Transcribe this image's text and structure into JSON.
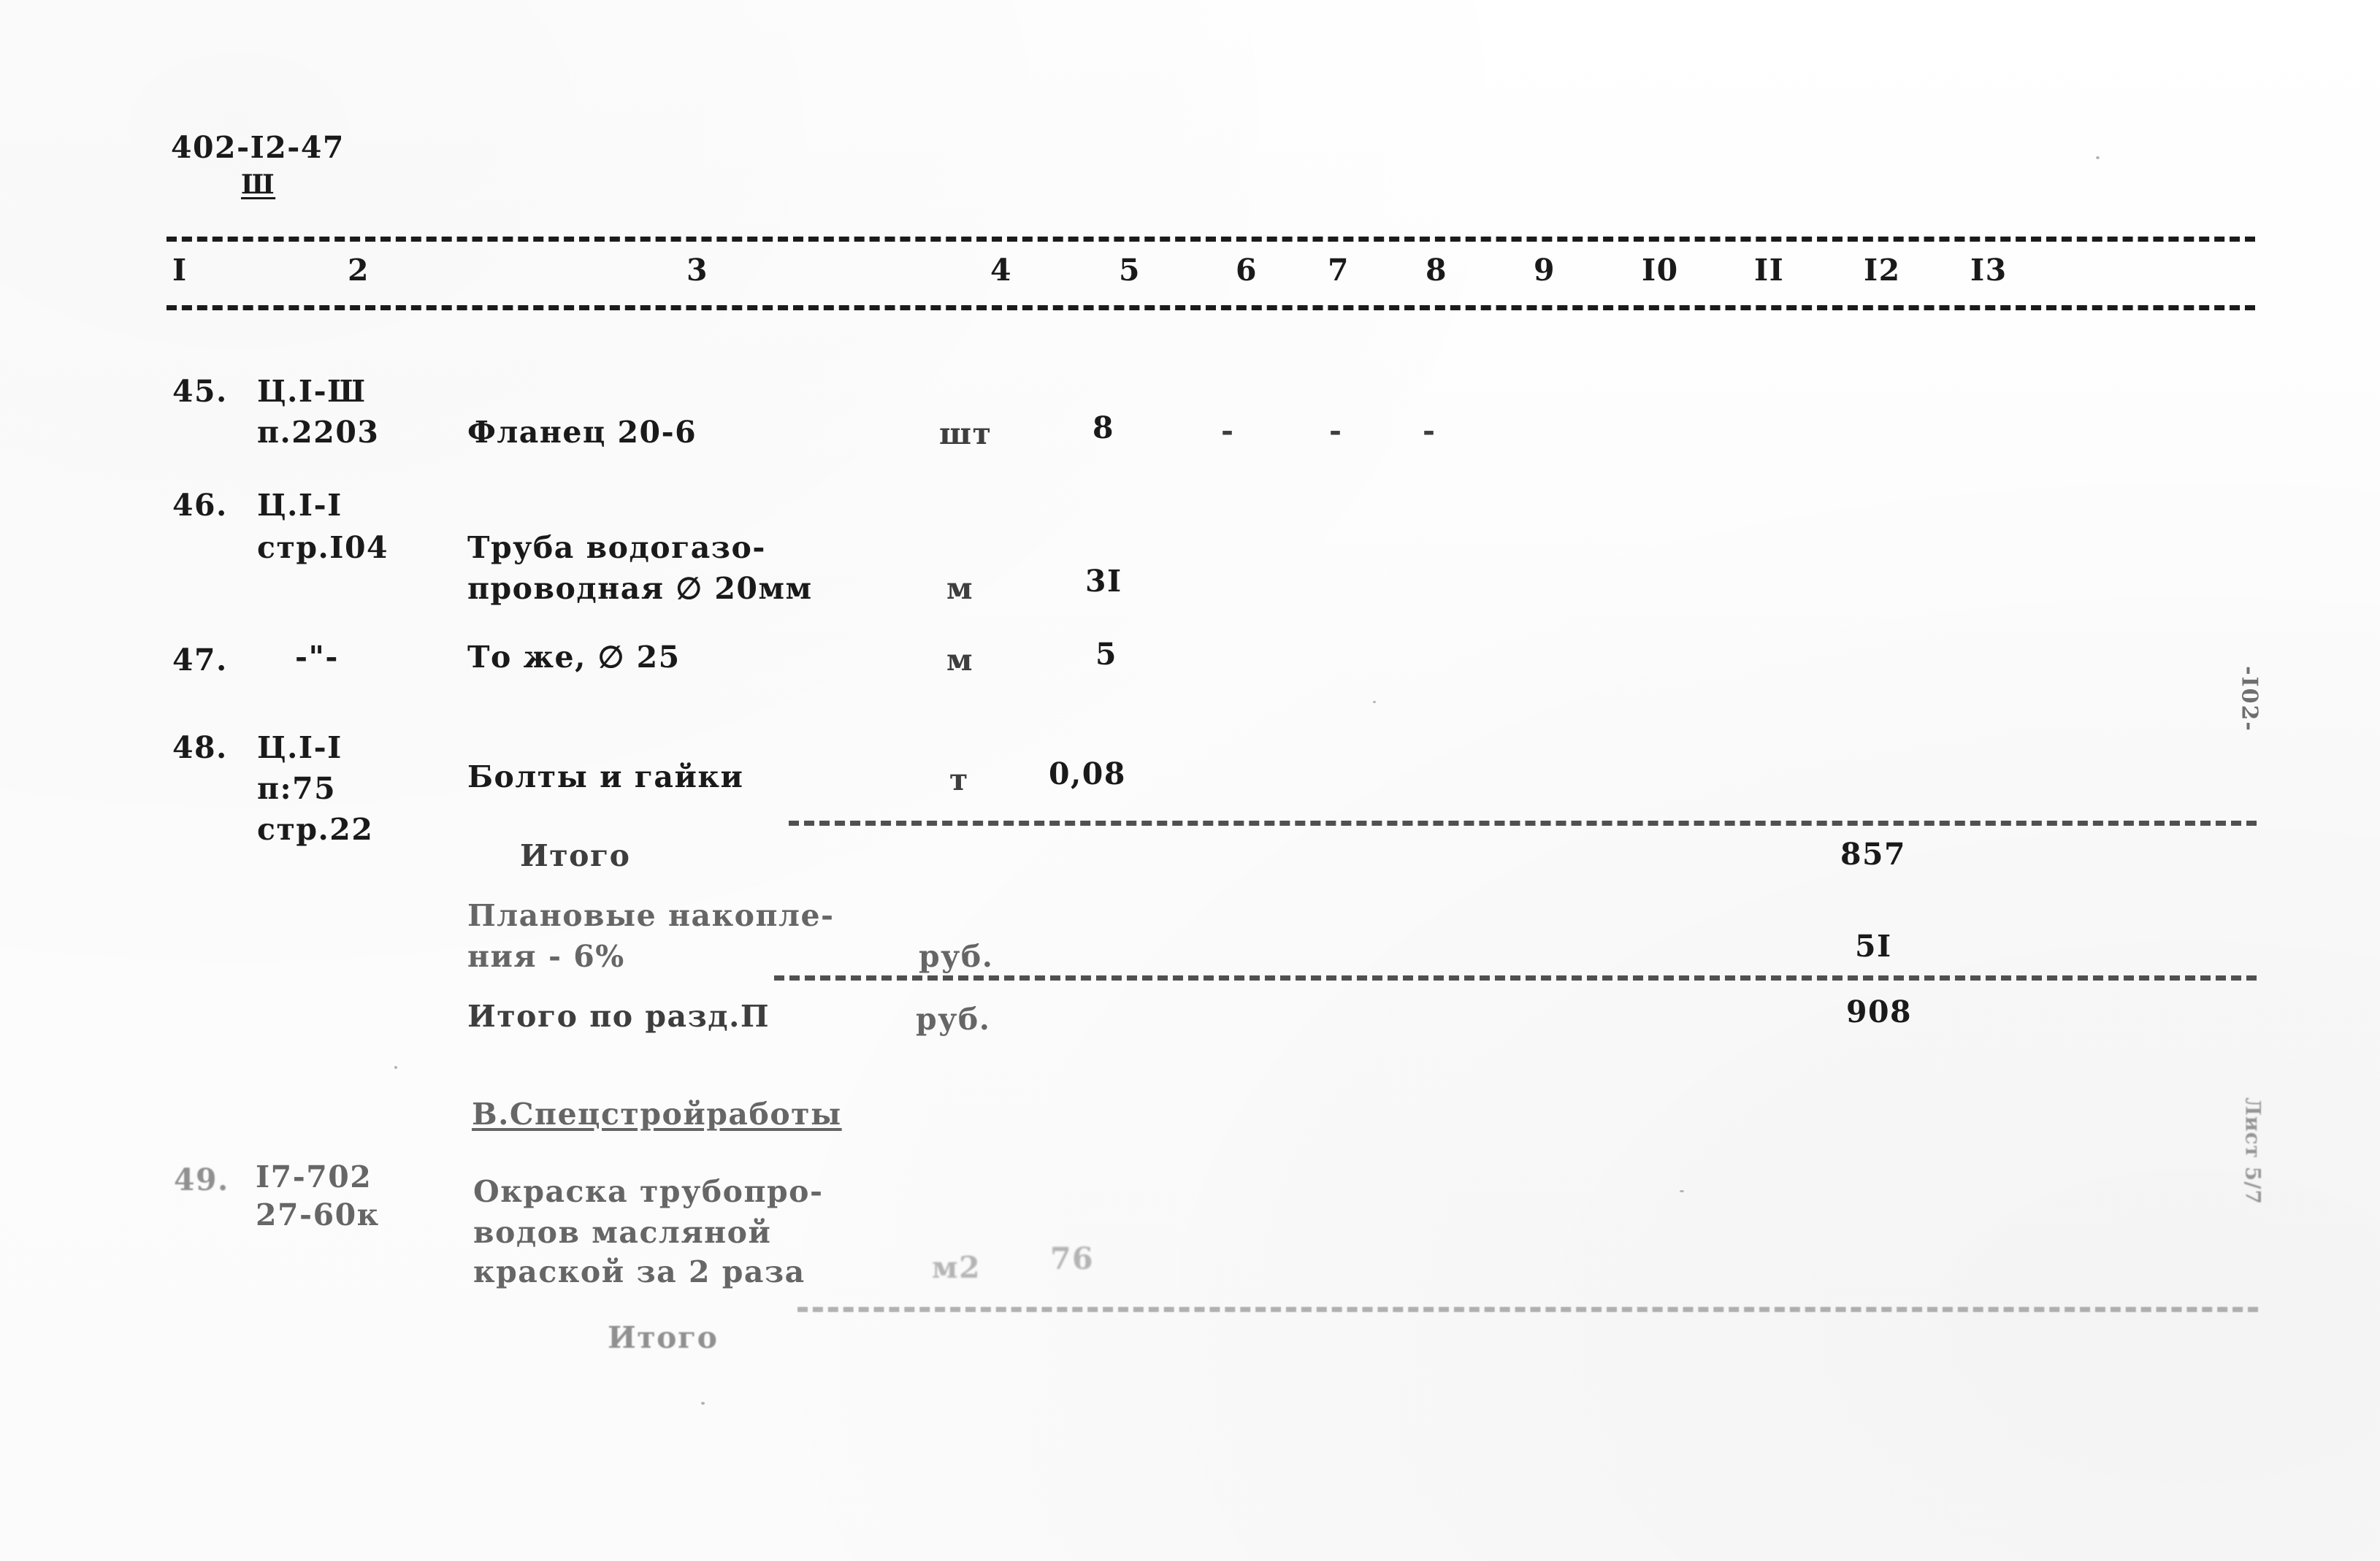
{
  "document": {
    "code": "402-I2-47",
    "sheet_marker": "Ш",
    "page_number_margin": "-I02-",
    "margin_stamp_lower": "Лист 5/7"
  },
  "table": {
    "column_headers": [
      "I",
      "2",
      "3",
      "4",
      "5",
      "6",
      "7",
      "8",
      "9",
      "I0",
      "II",
      "I2",
      "I3"
    ],
    "rows": [
      {
        "no": "45.",
        "ref_line1": "Ц.I-Ш",
        "ref_line2": "п.2203",
        "name_line1": "Фланец 20-6",
        "name_line2": "",
        "name_line3": "",
        "unit": "шт",
        "qty": "8",
        "c6": "-",
        "c7": "-",
        "c8": "-"
      },
      {
        "no": "46.",
        "ref_line1": "Ц.I-I",
        "ref_line2": "стр.I04",
        "name_line1": "Труба водогазо-",
        "name_line2": "проводная ∅ 20мм",
        "name_line3": "",
        "unit": "м",
        "qty": "3I",
        "c6": "",
        "c7": "",
        "c8": ""
      },
      {
        "no": "47.",
        "ref_line1": "-\"-",
        "ref_line2": "",
        "name_line1": "То же, ∅ 25",
        "name_line2": "",
        "name_line3": "",
        "unit": "м",
        "qty": "5",
        "c6": "",
        "c7": "",
        "c8": ""
      },
      {
        "no": "48.",
        "ref_line1": "Ц.I-I",
        "ref_line2": "п:75",
        "ref_line3": "стр.22",
        "name_line1": "Болты и гайки",
        "name_line2": "",
        "name_line3": "",
        "unit": "т",
        "qty": "0,08",
        "c6": "",
        "c7": "",
        "c8": ""
      }
    ],
    "totals": [
      {
        "label": "Итого",
        "label2": "",
        "unit": "",
        "value": "857"
      },
      {
        "label": "Плановые накопле-",
        "label2": "ния - 6%",
        "unit": "руб.",
        "value": "5I"
      },
      {
        "label": "Итого по разд.П",
        "label2": "",
        "unit": "руб.",
        "value": "908"
      }
    ],
    "section": {
      "heading": "В.Спецстройработы",
      "row": {
        "no": "49.",
        "ref_line1": "I7-702",
        "ref_line2": "27-60к",
        "name_line1": "Окраска трубопро-",
        "name_line2": "водов масляной",
        "name_line3": "краской за 2 раза",
        "unit": "м2",
        "qty": "76"
      },
      "total_label": "Итого"
    }
  }
}
